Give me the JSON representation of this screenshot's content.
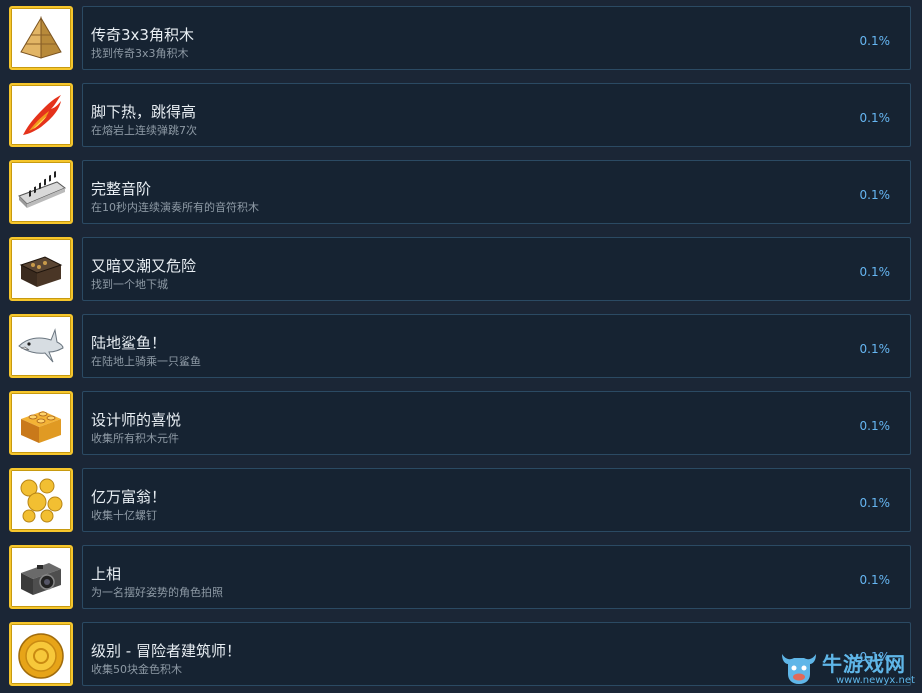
{
  "achievements": [
    {
      "title": "传奇3x3角积木",
      "description": "找到传奇3x3角积木",
      "percent": "0.1%",
      "icon": "pyramid-brick-icon"
    },
    {
      "title": "脚下热，跳得高",
      "description": "在熔岩上连续弹跳7次",
      "percent": "0.1%",
      "icon": "flame-icon"
    },
    {
      "title": "完整音阶",
      "description": "在10秒内连续演奏所有的音符积木",
      "percent": "0.1%",
      "icon": "keyboard-icon"
    },
    {
      "title": "又暗又潮又危险",
      "description": "找到一个地下城",
      "percent": "0.1%",
      "icon": "dungeon-chest-icon"
    },
    {
      "title": "陆地鲨鱼！",
      "description": "在陆地上骑乘一只鲨鱼",
      "percent": "0.1%",
      "icon": "shark-icon"
    },
    {
      "title": "设计师的喜悦",
      "description": "收集所有积木元件",
      "percent": "0.1%",
      "icon": "gold-brick-icon"
    },
    {
      "title": "亿万富翁！",
      "description": "收集十亿螺钉",
      "percent": "0.1%",
      "icon": "gold-studs-icon"
    },
    {
      "title": "上相",
      "description": "为一名摆好姿势的角色拍照",
      "percent": "0.1%",
      "icon": "camera-icon"
    },
    {
      "title": "级别 - 冒险者建筑师！",
      "description": "收集50块金色积木",
      "percent": "0.1%",
      "icon": "gold-coin-icon"
    }
  ],
  "watermark": {
    "name": "牛游戏网",
    "url": "www.newyx.net"
  },
  "colors": {
    "background": "#1b2636",
    "card_border": "#2b4a63",
    "percent": "#66b6f2",
    "icon_frame": "#f6c62c"
  }
}
